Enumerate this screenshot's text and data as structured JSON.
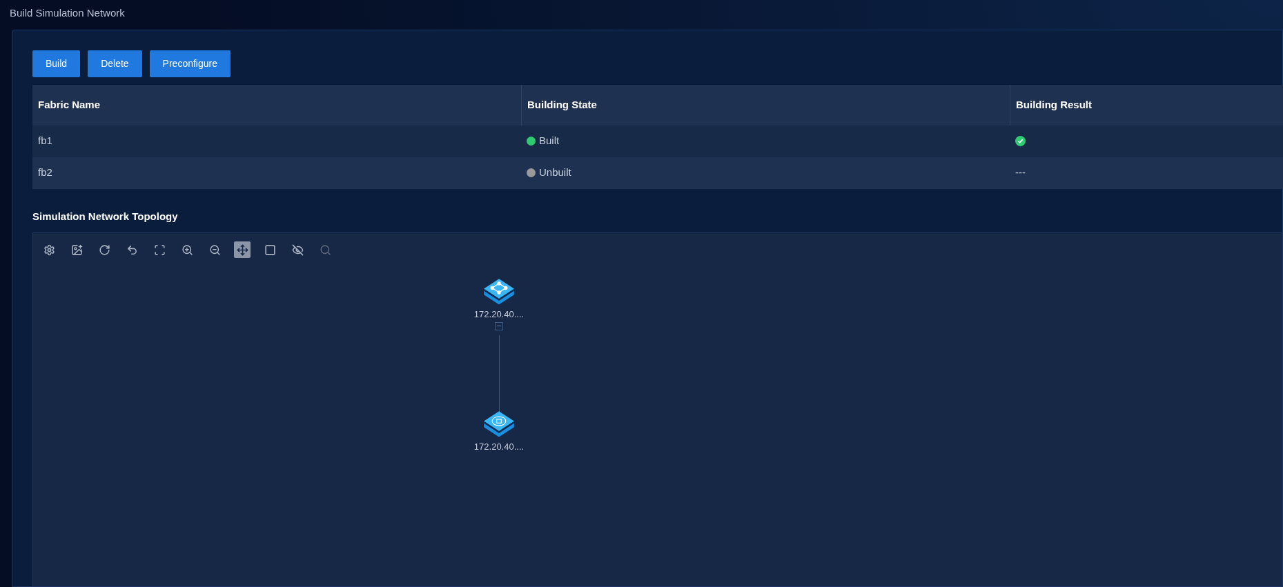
{
  "page_title": "Build Simulation Network",
  "buttons": [
    "Build",
    "Delete",
    "Preconfigure"
  ],
  "table": {
    "columns": [
      "Fabric Name",
      "Building State",
      "Building Result"
    ],
    "rows": [
      {
        "name": "fb1",
        "state": "Built",
        "color": "#2ecc71",
        "result": {
          "kind": "check"
        }
      },
      {
        "name": "fb2",
        "state": "Unbuilt",
        "color": "#9a9a9a",
        "result": {
          "kind": "text",
          "text": "---"
        }
      }
    ]
  },
  "topology": {
    "title": "Simulation Network Topology",
    "tools": [
      {
        "kind": "settings",
        "selected": false,
        "disabled": false
      },
      {
        "kind": "image",
        "selected": false,
        "disabled": false
      },
      {
        "kind": "refresh",
        "selected": false,
        "disabled": false
      },
      {
        "kind": "undo",
        "selected": false,
        "disabled": false
      },
      {
        "kind": "frame",
        "selected": false,
        "disabled": false
      },
      {
        "kind": "zoom-in",
        "selected": false,
        "disabled": false
      },
      {
        "kind": "zoom-out",
        "selected": false,
        "disabled": false
      },
      {
        "kind": "center",
        "selected": true,
        "disabled": false
      },
      {
        "kind": "fullscreen",
        "selected": false,
        "disabled": false
      },
      {
        "kind": "hide",
        "selected": false,
        "disabled": false
      },
      {
        "kind": "search",
        "selected": false,
        "disabled": true
      }
    ],
    "nodes": [
      {
        "kind": "router",
        "label": "172.20.40....",
        "expanded": true
      },
      {
        "kind": "switch",
        "label": "172.20.40....",
        "expanded": false
      }
    ]
  }
}
